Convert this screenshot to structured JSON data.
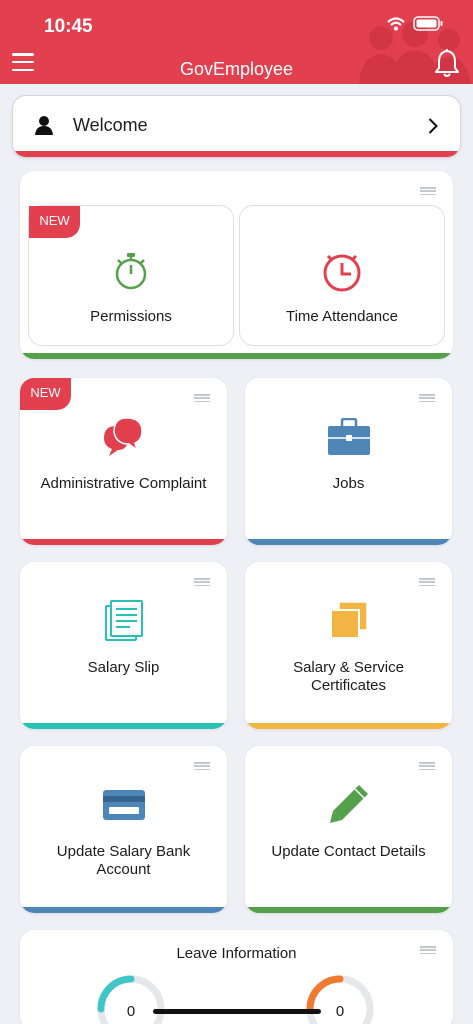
{
  "status": {
    "time": "10:45"
  },
  "header": {
    "title": "GovEmployee"
  },
  "welcome": {
    "label": "Welcome"
  },
  "group": {
    "tiles": [
      {
        "label": "Permissions",
        "badge": "NEW",
        "icon": "stopwatch-icon",
        "color": "#55a04a"
      },
      {
        "label": "Time Attendance",
        "icon": "clock-icon",
        "color": "#e3404f"
      }
    ],
    "accent": "#55a04a"
  },
  "tiles": [
    {
      "label": "Administrative Complaint",
      "badge": "NEW",
      "icon": "chat-bubbles-icon",
      "accent": "#e3404f"
    },
    {
      "label": "Jobs",
      "icon": "briefcase-icon",
      "accent": "#4f86b8"
    },
    {
      "label": "Salary Slip",
      "icon": "document-lines-icon",
      "accent": "#27c2b4"
    },
    {
      "label": "Salary & Service Certificates",
      "icon": "stacked-documents-icon",
      "accent": "#f2b544"
    },
    {
      "label": "Update Salary Bank Account",
      "icon": "credit-card-icon",
      "accent": "#4f86b8"
    },
    {
      "label": "Update Contact Details",
      "icon": "pencil-icon",
      "accent": "#55a04a"
    }
  ],
  "leave": {
    "title": "Leave Information",
    "gauges": [
      {
        "value": "0",
        "color": "#41c6c7"
      },
      {
        "value": "0",
        "color": "#ef7a31"
      }
    ]
  }
}
